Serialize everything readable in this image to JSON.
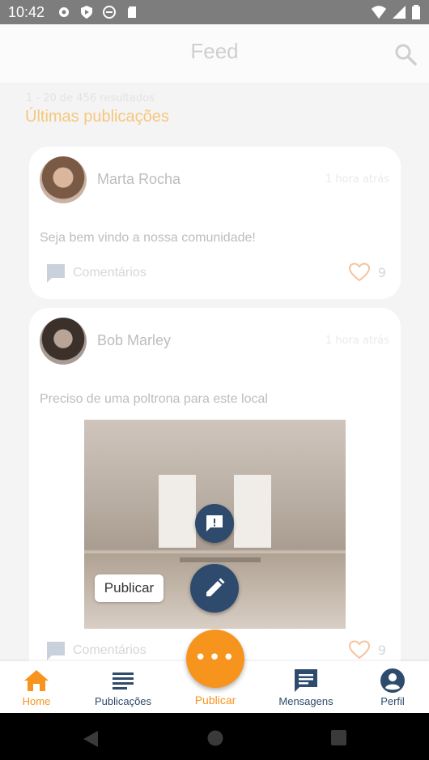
{
  "status_bar": {
    "time": "10:42",
    "icons": [
      "settings-icon",
      "play-protect-icon",
      "sync-icon",
      "sd-card-icon"
    ],
    "right_icons": [
      "wifi-icon",
      "signal-icon",
      "battery-icon"
    ]
  },
  "app_bar": {
    "title": "Feed",
    "search_icon": "search-icon"
  },
  "feed": {
    "results_text": "1 - 20 de 456 resultados",
    "section_title": "Últimas publicações",
    "posts": [
      {
        "author": "Marta Rocha",
        "time": "1 hora atrás",
        "text": "Seja bem vindo a nossa comunidade!",
        "comments_label": "Comentários",
        "likes": "9"
      },
      {
        "author": "Bob Marley",
        "time": "1 hora atrás",
        "text": "Preciso de uma poltrona para este local",
        "comments_label": "Comentários",
        "likes": "9"
      }
    ]
  },
  "fab_menu": {
    "publish_label": "Publicar"
  },
  "bottom_nav": {
    "items": [
      {
        "label": "Home",
        "icon": "home-icon",
        "active": true
      },
      {
        "label": "Publicações",
        "icon": "list-icon",
        "active": false
      },
      {
        "label": "Publicar",
        "icon": "more-icon",
        "active": false
      },
      {
        "label": "Mensagens",
        "icon": "message-icon",
        "active": false
      },
      {
        "label": "Perfil",
        "icon": "account-icon",
        "active": false
      }
    ]
  },
  "colors": {
    "accent": "#f7941d",
    "primary_dark": "#2e4b6d",
    "status_bar": "#7d7d7d"
  }
}
